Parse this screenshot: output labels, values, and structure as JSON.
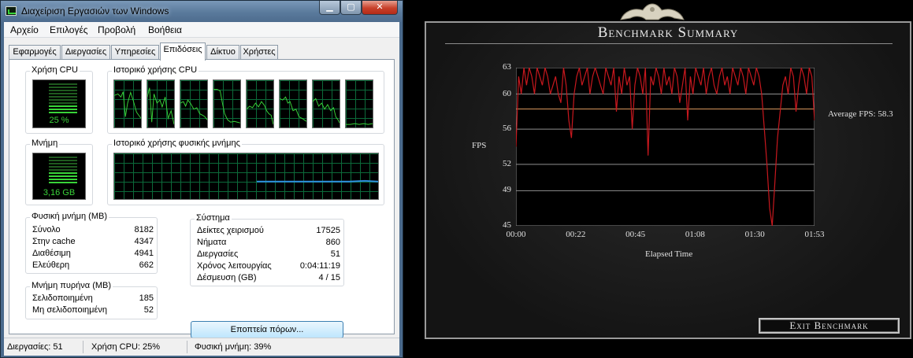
{
  "task_manager": {
    "title": "Διαχείριση Εργασιών των Windows",
    "window_buttons": {
      "minimize": "▁",
      "maximize": "▢",
      "close": "✕"
    },
    "menu": [
      "Αρχείο",
      "Επιλογές",
      "Προβολή",
      "Βοήθεια"
    ],
    "tabs": [
      "Εφαρμογές",
      "Διεργασίες",
      "Υπηρεσίες",
      "Επιδόσεις",
      "Δίκτυο",
      "Χρήστες"
    ],
    "active_tab": "Επιδόσεις",
    "cpu_usage": {
      "label": "Χρήση CPU",
      "value": "25 %",
      "level": 0.25
    },
    "cpu_history": {
      "label": "Ιστορικό χρήσης CPU",
      "cores": 8
    },
    "memory": {
      "label": "Μνήμη",
      "value": "3,16 GB",
      "level": 0.39
    },
    "memory_history": {
      "label": "Ιστορικό χρήσης φυσικής μνήμης"
    },
    "physical_memory": {
      "label": "Φυσική μνήμη (MB)",
      "rows": [
        {
          "label": "Σύνολο",
          "value": "8182"
        },
        {
          "label": "Στην cache",
          "value": "4347"
        },
        {
          "label": "Διαθέσιμη",
          "value": "4941"
        },
        {
          "label": "Ελεύθερη",
          "value": "662"
        }
      ]
    },
    "kernel_memory": {
      "label": "Μνήμη πυρήνα (MB)",
      "rows": [
        {
          "label": "Σελιδοποιημένη",
          "value": "185"
        },
        {
          "label": "Μη σελιδοποιημένη",
          "value": "52"
        }
      ]
    },
    "system": {
      "label": "Σύστημα",
      "rows": [
        {
          "label": "Δείκτες χειρισμού",
          "value": "17525"
        },
        {
          "label": "Νήματα",
          "value": "860"
        },
        {
          "label": "Διεργασίες",
          "value": "51"
        },
        {
          "label": "Χρόνος λειτουργίας",
          "value": "0:04:11:19"
        },
        {
          "label": "Δέσμευση (GB)",
          "value": "4 / 15"
        }
      ]
    },
    "resource_monitor_button": "Εποπτεία πόρων...",
    "status": {
      "processes": "Διεργασίες: 51",
      "cpu": "Χρήση CPU: 25%",
      "memory": "Φυσική μνήμη: 39%"
    },
    "colors": {
      "graph_line": "#39d439",
      "memory_line": "#2e8fe0",
      "grid": "#0c6a3a"
    }
  },
  "benchmark": {
    "title": "Benchmark Summary",
    "average_label": "Average FPS: 58.3",
    "exit_button": "Exit Benchmark",
    "colors": {
      "line": "#c8181e",
      "average": "#d6955c",
      "grid": "#8f8f8f"
    }
  },
  "chart_data": {
    "type": "line",
    "title": "Benchmark Summary",
    "xlabel": "Elapsed Time",
    "ylabel": "FPS",
    "ylim": [
      45,
      63
    ],
    "yticks": [
      "63",
      "60",
      "56",
      "52",
      "49",
      "45"
    ],
    "ytick_values": [
      63,
      60,
      56,
      52,
      49,
      45
    ],
    "xticks": [
      "00:00",
      "00:22",
      "00:45",
      "01:08",
      "01:30",
      "01:53"
    ],
    "xlim_seconds": [
      0,
      113
    ],
    "average": 58.3,
    "series": [
      {
        "name": "FPS",
        "t_seconds": [
          0,
          1,
          2,
          3,
          4,
          5,
          6,
          7,
          8,
          9,
          10,
          11,
          12,
          13,
          14,
          15,
          16,
          17,
          18,
          19,
          20,
          21,
          22,
          23,
          24,
          25,
          26,
          27,
          28,
          29,
          30,
          31,
          32,
          33,
          34,
          35,
          36,
          37,
          38,
          39,
          40,
          41,
          42,
          43,
          44,
          45,
          46,
          47,
          48,
          49,
          50,
          51,
          52,
          53,
          54,
          55,
          56,
          57,
          58,
          59,
          60,
          61,
          62,
          63,
          64,
          65,
          66,
          67,
          68,
          69,
          70,
          71,
          72,
          73,
          74,
          75,
          76,
          77,
          78,
          79,
          80,
          81,
          82,
          83,
          84,
          85,
          86,
          87,
          88,
          89,
          90,
          91,
          92,
          93,
          94,
          95,
          96,
          97,
          98,
          99,
          100,
          101,
          102,
          103,
          104,
          105,
          106,
          107,
          108,
          109,
          110,
          111,
          112,
          113
        ],
        "values": [
          54,
          62,
          60,
          63,
          61,
          63,
          62,
          60,
          63,
          62,
          61,
          63,
          62,
          60,
          61,
          62,
          60,
          59,
          63,
          61,
          57,
          55,
          60,
          62,
          63,
          61,
          62,
          63,
          60,
          62,
          63,
          62,
          61,
          60,
          63,
          62,
          61,
          63,
          58,
          62,
          60,
          63,
          61,
          62,
          56,
          61,
          63,
          62,
          60,
          63,
          53,
          62,
          61,
          63,
          62,
          60,
          63,
          61,
          62,
          60,
          63,
          62,
          59,
          61,
          63,
          57,
          62,
          60,
          63,
          62,
          61,
          63,
          60,
          62,
          63,
          61,
          60,
          62,
          63,
          61,
          62,
          60,
          63,
          62,
          61,
          63,
          62,
          60,
          63,
          62,
          61,
          63,
          62,
          60,
          56,
          52,
          47,
          45,
          50,
          55,
          58,
          61,
          62,
          60,
          63,
          62,
          58,
          61,
          63,
          62,
          60,
          63,
          62,
          57
        ]
      }
    ]
  }
}
